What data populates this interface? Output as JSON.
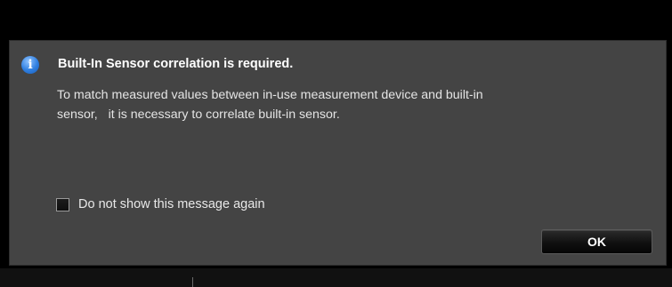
{
  "dialog": {
    "icon": "info-icon",
    "icon_glyph": "i",
    "title": "Built-In Sensor correlation is required.",
    "message": "To match measured values between in-use measurement device and built-in\nsensor,   it is necessary to correlate built-in sensor.",
    "checkbox_label": "Do not show this message again",
    "checkbox_checked": false,
    "ok_label": "OK"
  },
  "colors": {
    "dialog_background": "#444444",
    "backdrop": "#000000",
    "info_icon": "#2f7fe0",
    "button_background": "#101010"
  }
}
